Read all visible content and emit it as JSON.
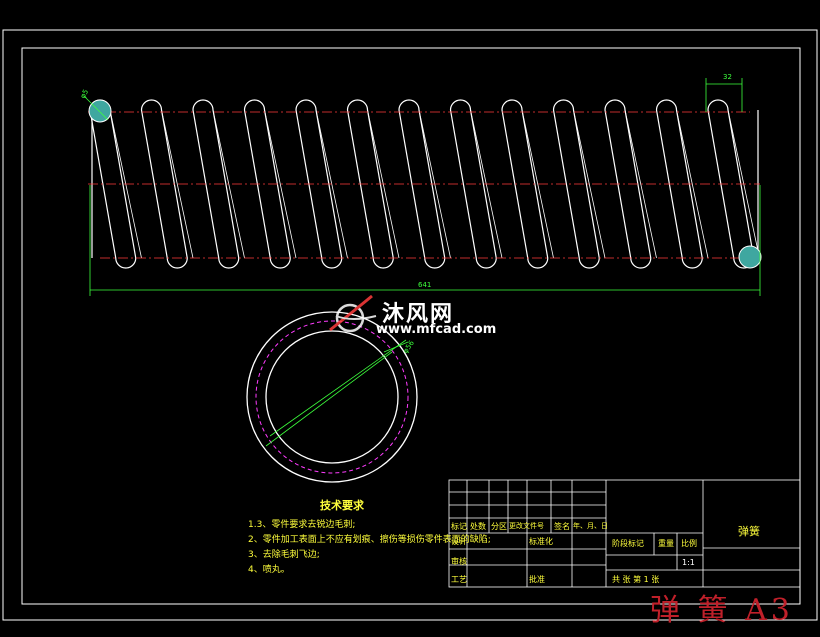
{
  "dimensions": {
    "dia_top_left": "φ5",
    "pitch": "32",
    "total_length": "641",
    "dia_ring": "φ56"
  },
  "tech_req": {
    "title": "技术要求",
    "items": [
      "1.3、零件要求去锐边毛刺;",
      "2、零件加工表面上不应有划痕、擦伤等损伤零件表面的缺陷;",
      "3、去除毛刺飞边;",
      "4、喷丸。"
    ]
  },
  "title_block": {
    "hdr_mark": "标记",
    "hdr_count": "处数",
    "hdr_zone": "分区",
    "hdr_docno": "更改文件号",
    "hdr_sign": "签名",
    "hdr_date": "年、月、日",
    "design": "设计",
    "standard": "标准化",
    "stage_mark": "阶段标记",
    "weight": "重量",
    "scale": "比例",
    "scale_value": "1:1",
    "review": "审核",
    "process": "工艺",
    "approve": "批准",
    "sheet": "共    张  第 1 张",
    "part_name": "弹簧"
  },
  "watermark": {
    "text": "沐风网",
    "url": "www.mfcad.com"
  },
  "stamp": "弹 簧 A3",
  "colors": {
    "line": "#ffffff",
    "dim": "#3cff3c",
    "center": "#ff3c3c",
    "hidden": "#ff3cff",
    "text": "#ffff3c",
    "section_fill": "#3fa7a0"
  }
}
